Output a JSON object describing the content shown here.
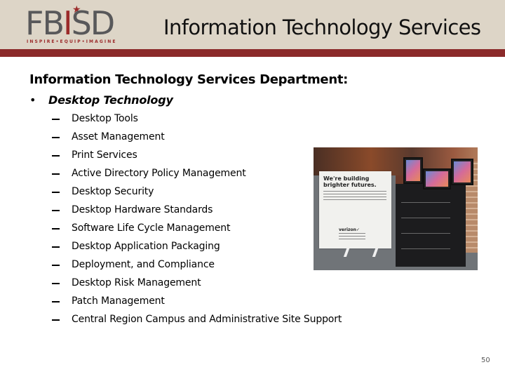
{
  "header": {
    "logo": {
      "letters_left": "FB",
      "letter_accent": "I",
      "letters_right": "SD",
      "tagline": "INSPIRE•EQUIP•IMAGINE",
      "star_icon": "★"
    },
    "title": "Information Technology Services"
  },
  "content": {
    "heading": "Information Technology Services Department:",
    "bullet_symbol": "•",
    "section": {
      "label": "Desktop Technology",
      "items": [
        "Desktop Tools",
        "Asset Management",
        "Print Services",
        "Active Directory Policy Management",
        "Desktop Security",
        "Desktop Hardware Standards",
        "Software Life Cycle Management",
        "Desktop Application Packaging",
        "Deployment, and Compliance",
        "Desktop Risk Management",
        "Patch Management",
        "Central Region Campus and Administrative Site Support"
      ]
    }
  },
  "photo": {
    "banner_headline": "We're building brighter futures.",
    "banner_brand": "verizon✓"
  },
  "footer": {
    "page_number": "50"
  },
  "colors": {
    "header_background": "#ddd5c7",
    "accent_bar": "#8b2a2a",
    "logo_gray": "#58585a",
    "logo_red": "#9b2a2a"
  }
}
